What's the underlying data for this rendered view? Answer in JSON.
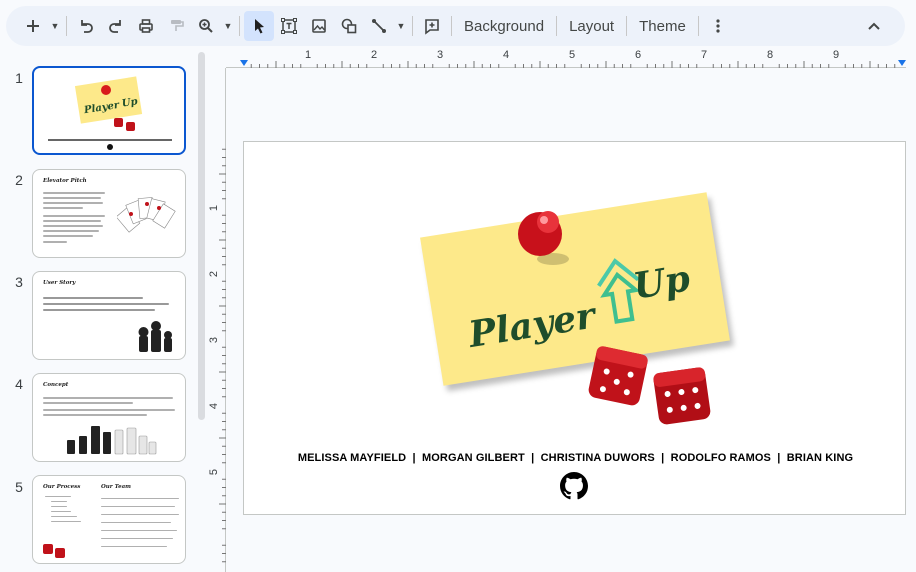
{
  "toolbar": {
    "new_icon": "plus-icon",
    "background_label": "Background",
    "layout_label": "Layout",
    "theme_label": "Theme"
  },
  "ruler": {
    "top_numbers": [
      "1",
      "2",
      "3",
      "4",
      "5",
      "6",
      "7",
      "8",
      "9"
    ],
    "left_numbers": [
      "1",
      "2",
      "3",
      "4",
      "5"
    ]
  },
  "slides": [
    {
      "number": "1",
      "thumb_title": "",
      "thumb_names": "MELISSA MAYFIELD | MORGAN GILBERT | CHRISTINA DUWORS | RODOLFO RAMOS | BRIAN KING"
    },
    {
      "number": "2",
      "thumb_title": "Elevator Pitch"
    },
    {
      "number": "3",
      "thumb_title": "User Story"
    },
    {
      "number": "4",
      "thumb_title": "Concept"
    },
    {
      "number": "5",
      "thumb_title": "Our Process",
      "thumb_title2": "Our Team"
    }
  ],
  "main_slide": {
    "logo_word1": "Player",
    "logo_word2": "Up",
    "names": "MELISSA MAYFIELD  |  MORGAN GILBERT  |  CHRISTINA DUWORS  |  RODOLFO RAMOS  |  BRIAN KING"
  },
  "colors": {
    "accent": "#0b57d0",
    "sticky_note": "#fde98a",
    "logo_text": "#1e4d2b",
    "dice": "#c0121a"
  }
}
